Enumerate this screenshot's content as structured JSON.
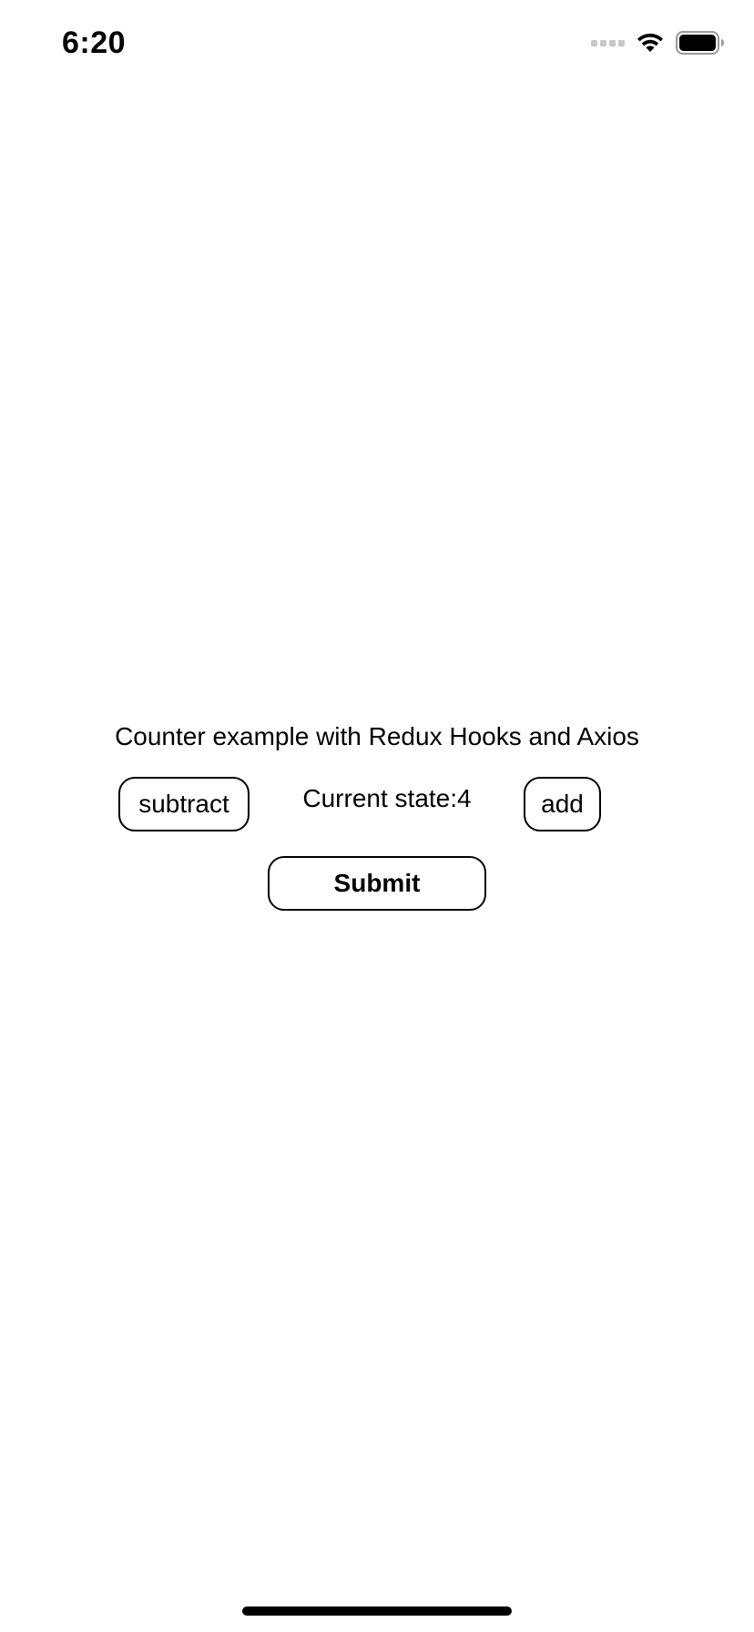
{
  "status_bar": {
    "time": "6:20"
  },
  "app": {
    "title": "Counter example with Redux Hooks and Axios",
    "subtract_label": "subtract",
    "add_label": "add",
    "state_text": "Current state:4",
    "submit_label": "Submit"
  },
  "icons": {
    "signal": "cellular-signal-icon",
    "wifi": "wifi-icon",
    "battery": "battery-icon"
  }
}
